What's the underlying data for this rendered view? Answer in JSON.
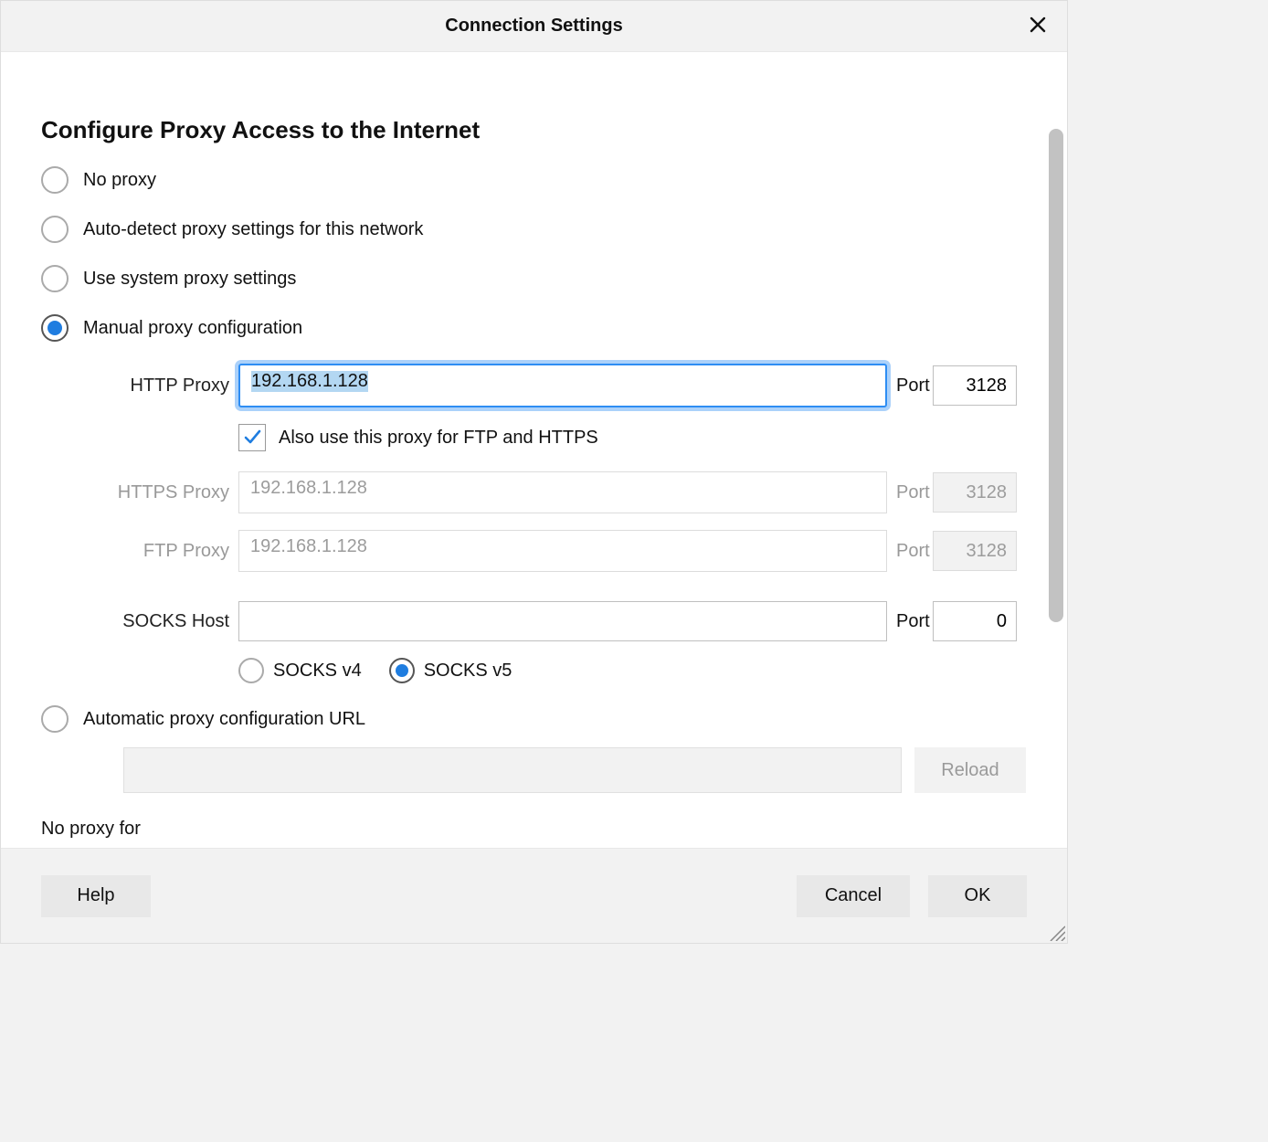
{
  "dialog": {
    "title": "Connection Settings",
    "heading": "Configure Proxy Access to the Internet"
  },
  "radios": {
    "no_proxy": "No proxy",
    "auto_detect": "Auto-detect proxy settings for this network",
    "system": "Use system proxy settings",
    "manual": "Manual proxy configuration",
    "auto_url": "Automatic proxy configuration URL"
  },
  "labels": {
    "http": "HTTP Proxy",
    "https": "HTTPS Proxy",
    "ftp": "FTP Proxy",
    "socks": "SOCKS Host",
    "port": "Port",
    "also_use": "Also use this proxy for FTP and HTTPS",
    "socks_v4": "SOCKS v4",
    "socks_v5": "SOCKS v5",
    "reload": "Reload",
    "no_proxy_for": "No proxy for"
  },
  "values": {
    "http_host": "192.168.1.128",
    "http_port": "3128",
    "https_host": "192.168.1.128",
    "https_port": "3128",
    "ftp_host": "192.168.1.128",
    "ftp_port": "3128",
    "socks_host": "",
    "socks_port": "0"
  },
  "buttons": {
    "help": "Help",
    "cancel": "Cancel",
    "ok": "OK"
  }
}
